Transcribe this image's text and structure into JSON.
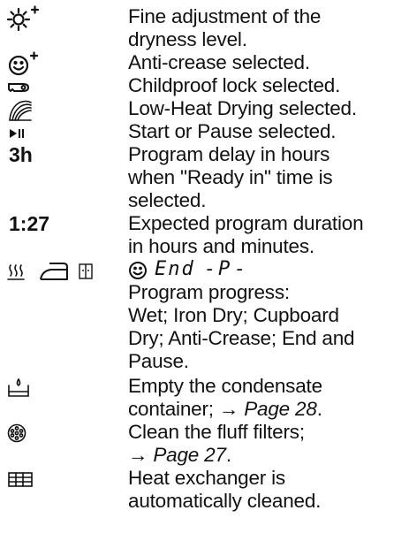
{
  "rows": {
    "dryness": {
      "icon": "sun-plus-icon",
      "lines": [
        "Fine adjustment of the",
        "dryness level."
      ]
    },
    "anticrease": {
      "icon": "anti-crease-plus-icon",
      "lines": [
        "Anti-crease selected."
      ]
    },
    "childlock": {
      "icon": "key-icon",
      "lines": [
        "Childproof lock selected."
      ]
    },
    "lowheat": {
      "icon": "low-heat-icon",
      "lines": [
        "Low-Heat Drying selected."
      ]
    },
    "startpause": {
      "icon": "play-pause-icon",
      "lines": [
        "Start or Pause selected."
      ]
    },
    "delay": {
      "symbol": "3h",
      "lines": [
        "Program delay in hours",
        "when \"Ready in\" time is",
        "selected."
      ]
    },
    "duration": {
      "symbol": "1:27",
      "lines": [
        "Expected program duration",
        "in hours and minutes."
      ]
    },
    "progress": {
      "icons": [
        "wet-icon",
        "iron-icon",
        "cupboard-icon"
      ],
      "display_end": "End",
      "display_sep1": "-",
      "display_p": "P",
      "display_sep2": "-",
      "lines": [
        "Program progress:",
        "Wet; Iron Dry; Cupboard",
        "Dry; Anti-Crease; End and",
        "Pause."
      ]
    },
    "condensate": {
      "icon": "condensate-container-icon",
      "line1": "Empty the condensate",
      "line2_text": "container;",
      "line2_arrow": "→",
      "line2_page": "Page 28",
      "line2_end": "."
    },
    "fluff": {
      "icon": "fluff-filter-icon",
      "line1": "Clean the fluff filters;",
      "line2_arrow": "→",
      "line2_page": "Page 27",
      "line2_end": "."
    },
    "heatexchanger": {
      "icon": "heat-exchanger-icon",
      "lines": [
        "Heat exchanger is",
        "automatically cleaned."
      ]
    }
  }
}
